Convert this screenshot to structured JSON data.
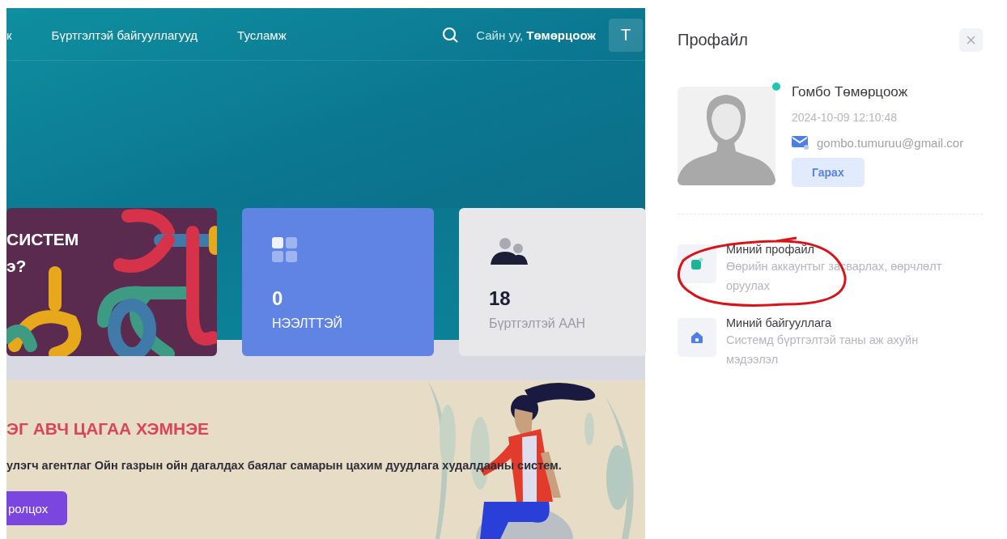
{
  "nav": {
    "items": [
      {
        "label": "к"
      },
      {
        "label": "Бүртгэлтэй байгууллагууд"
      },
      {
        "label": "Тусламж"
      }
    ],
    "greeting": "Сайн уу, **Төмөрцоож**",
    "avatar_letter": "T"
  },
  "cards": [
    {
      "kind": "promo",
      "lines": [
        "СИСТЕМ",
        "э?"
      ]
    },
    {
      "kind": "highlight",
      "value": "0",
      "label": "НЭЭЛТТЭЙ"
    },
    {
      "kind": "plain",
      "value": "18",
      "label": "Бүртгэлтэй ААН"
    }
  ],
  "banner": {
    "title": "ЭГ АВЧ ЦАГАА ХЭМНЭЕ",
    "text": "улэгч агентлаг Ойн газрын ойн дагалдах баялаг самарын цахим дуудлага худалдааны систем.",
    "button": "ролцох"
  },
  "panel": {
    "title": "Профайл",
    "online": true,
    "name": "Гомбо Төмөрцоож",
    "timestamp": "2024-10-09 12:10:48",
    "email": "gombo.tumuruu@gmail.cor",
    "logout": "Гарах",
    "menu": [
      {
        "kind": "profile",
        "title": "Миний профайл",
        "description": "Өөрийн аккаунтыг засварлах, өөрчлөлт оруулах"
      },
      {
        "kind": "company",
        "title": "Миний байгууллага",
        "description": "Системд бүртгэлтэй таны аж ахуйн мэдээлэл"
      }
    ]
  }
}
